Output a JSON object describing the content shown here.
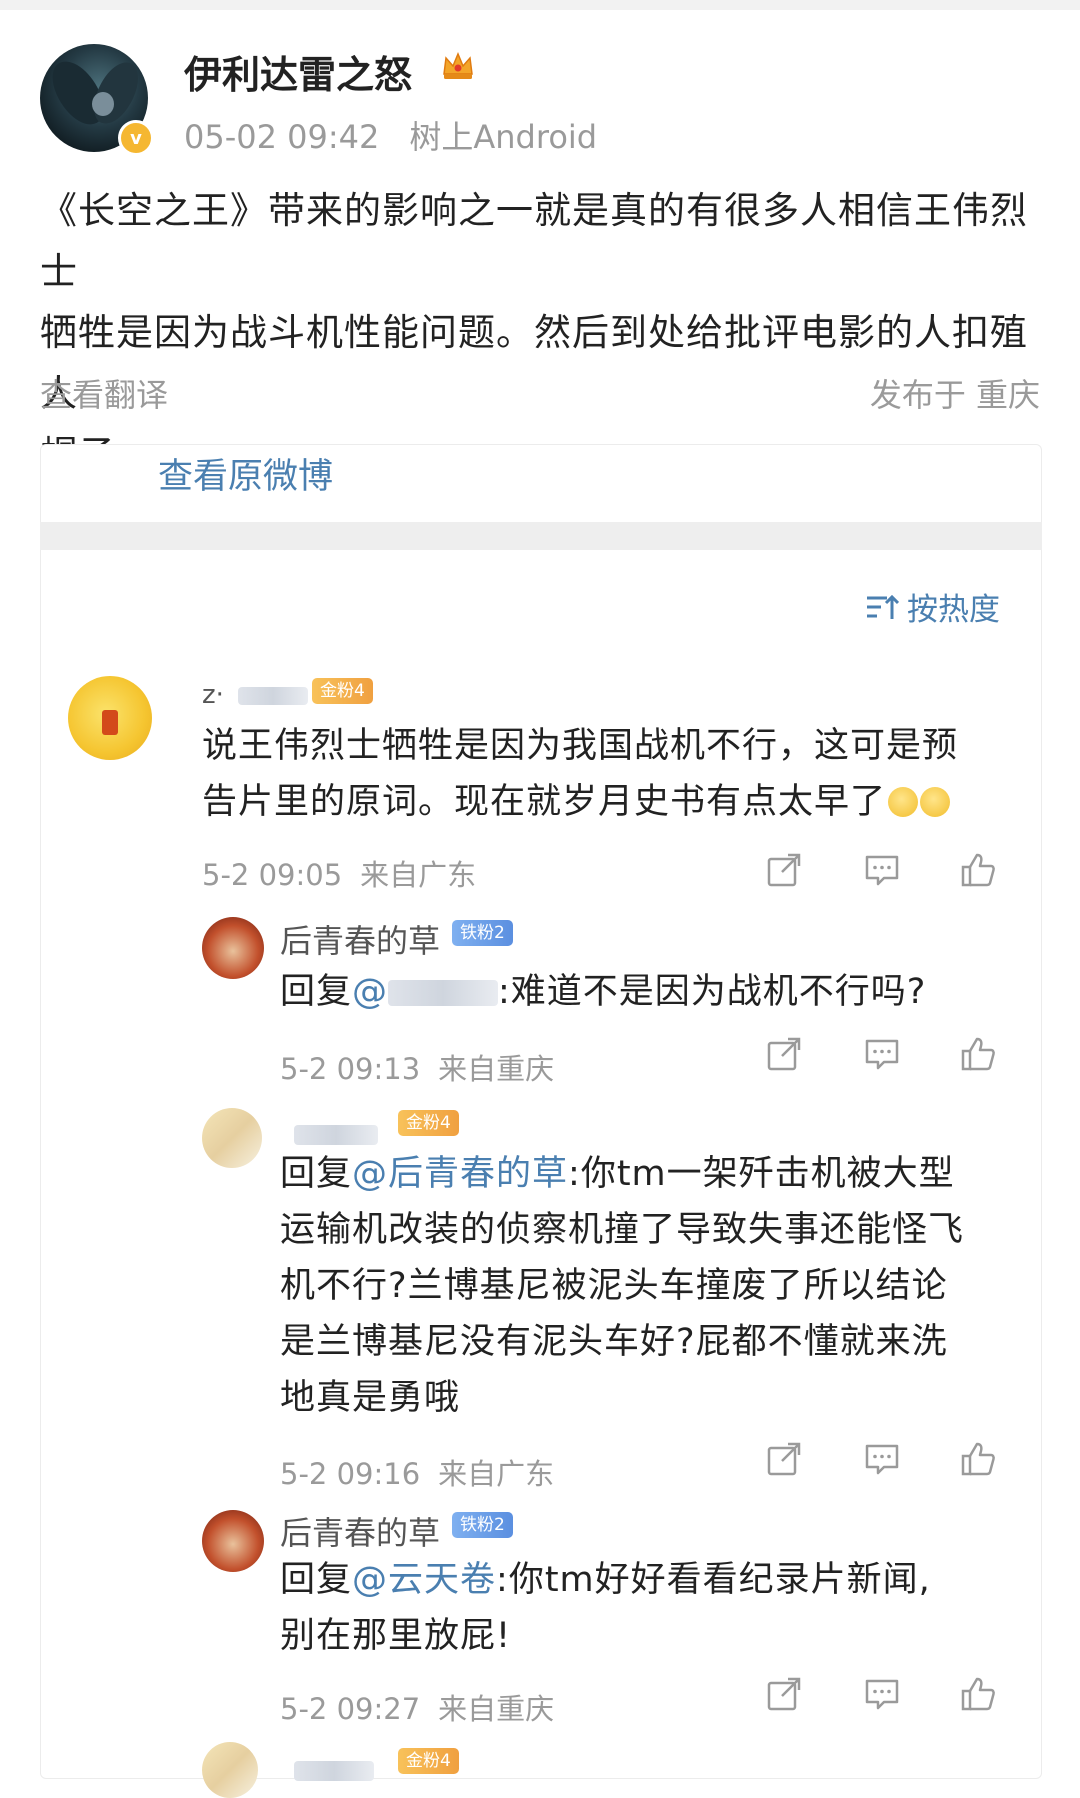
{
  "post": {
    "username": "伊利达雷之怒",
    "time": "05-02 09:42",
    "device": "树上Android",
    "text_line1": "《长空之王》带来的影响之一就是真的有很多人相信王伟烈士",
    "text_line2": "牺牲是因为战斗机性能问题。然后到处给批评电影的人扣殖人",
    "text_line3": "帽子。",
    "translate": "查看翻译",
    "location": "发布于 重庆"
  },
  "card": {
    "view_original": "查看原微博",
    "sort_label": "按热度"
  },
  "comments": [
    {
      "name_prefix": "z·",
      "badge": "金粉4",
      "line1": "说王伟烈士牺牲是因为我国战机不行，这可是预",
      "line2": "告片里的原词。现在就岁月史书有点太早了",
      "time": "5-2 09:05",
      "from": "来自广东"
    },
    {
      "name": "后青春的草",
      "badge": "铁粉2",
      "reply": "回复",
      "mention": "@",
      "text": ":难道不是因为战机不行吗?",
      "time": "5-2 09:13",
      "from": "来自重庆"
    },
    {
      "badge": "金粉4",
      "reply": "回复",
      "mention": "@后青春的草",
      "line1": ":你tm一架歼击机被大型",
      "line2": "运输机改装的侦察机撞了导致失事还能怪飞",
      "line3": "机不行?兰博基尼被泥头车撞废了所以结论",
      "line4": "是兰博基尼没有泥头车好?屁都不懂就来洗",
      "line5": "地真是勇哦",
      "time": "5-2 09:16",
      "from": "来自广东"
    },
    {
      "name": "后青春的草",
      "badge": "铁粉2",
      "reply": "回复",
      "mention": "@云天卷",
      "line1": ":你tm好好看看纪录片新闻,",
      "line2": "别在那里放屁!",
      "time": "5-2 09:27",
      "from": "来自重庆"
    },
    {
      "badge": "金粉4"
    }
  ],
  "icons": {
    "share": "share-icon",
    "comment": "comment-icon",
    "like": "like-icon",
    "crown": "crown-icon",
    "verified": "verified-badge-icon",
    "sort": "sort-icon"
  },
  "colors": {
    "link": "#4a7fb0",
    "muted": "#9a9a9a",
    "gold_badge": "#f0a040",
    "iron_badge": "#5b8fe0"
  }
}
